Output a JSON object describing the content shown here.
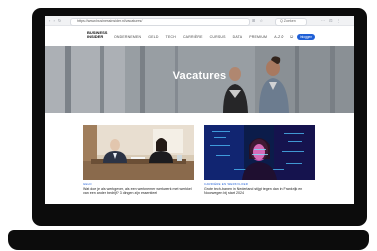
{
  "browser": {
    "nav_icons": "‹ › ↻",
    "url": "https://www.businessinsider.nl/vacatures/",
    "tools": "⊞ ☆",
    "find_text": "Q Zoeken",
    "extensions": "⋯ ⊡ ⋮"
  },
  "site": {
    "logo": "BUSINESS INSIDER",
    "menu": [
      "ONDERNEMEN",
      "GELD",
      "TECH",
      "CARRIÈRE",
      "CURSUS",
      "DATA",
      "PREMIUM",
      "A-Z"
    ],
    "search_icon": "⌕",
    "user_icon": "☺",
    "login_label": "Inloggen"
  },
  "hero": {
    "title": "Vacatures"
  },
  "articles": [
    {
      "tag": "GELD",
      "title": "Wat doe je als werkgever, als een werknemer werkwerk met werkkel van een ander bedrijf? 3 dingen zijn essentieel"
    },
    {
      "tag": "CARRIÈRE EN WERKVLOER",
      "title": "Grote tech-banen in Nederland stijgt tegen dan in Frankrijk en Noorwegen bij start 2024"
    }
  ],
  "colors": {
    "accent": "#1f5fd6",
    "frame": "#0c0c0c"
  }
}
